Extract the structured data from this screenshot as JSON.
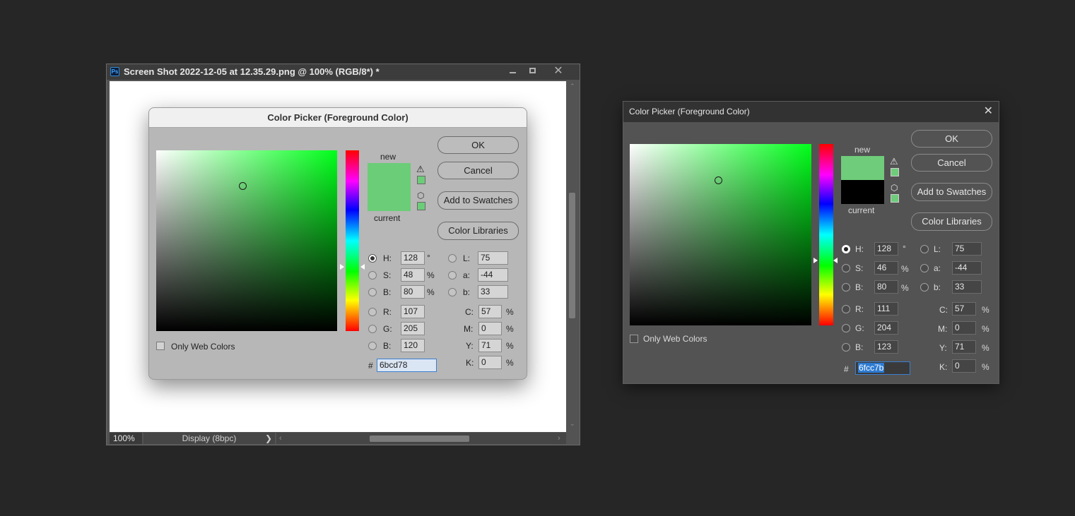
{
  "ps_window": {
    "title": "Screen Shot 2022-12-05 at 12.35.29.png @ 100% (RGB/8*) *",
    "logo": "Ps",
    "close_glyph": "✕",
    "zoom": "100%",
    "doc_info": "Display (8bpc)",
    "doc_info_arrow": "❯",
    "scroll_left": "‹",
    "scroll_right": "›",
    "scroll_up": "⌃",
    "scroll_down": "⌄"
  },
  "picker_light": {
    "title": "Color Picker (Foreground Color)",
    "new_label": "new",
    "current_label": "current",
    "new_color": "#6bcd78",
    "current_color": "#6bcd78",
    "hue_color": "#00ff1a",
    "buttons": {
      "ok": "OK",
      "cancel": "Cancel",
      "add_swatches": "Add to Swatches",
      "color_libraries": "Color Libraries"
    },
    "only_web_colors": "Only Web Colors",
    "fields": {
      "h": {
        "label": "H:",
        "value": "128",
        "unit": "°"
      },
      "s": {
        "label": "S:",
        "value": "48",
        "unit": "%"
      },
      "b": {
        "label": "B:",
        "value": "80",
        "unit": "%"
      },
      "r": {
        "label": "R:",
        "value": "107"
      },
      "g": {
        "label": "G:",
        "value": "205"
      },
      "bb": {
        "label": "B:",
        "value": "120"
      },
      "l": {
        "label": "L:",
        "value": "75"
      },
      "a": {
        "label": "a:",
        "value": "-44"
      },
      "lab_b": {
        "label": "b:",
        "value": "33"
      },
      "c": {
        "label": "C:",
        "value": "57",
        "unit": "%"
      },
      "m": {
        "label": "M:",
        "value": "0",
        "unit": "%"
      },
      "y": {
        "label": "Y:",
        "value": "71",
        "unit": "%"
      },
      "k": {
        "label": "K:",
        "value": "0",
        "unit": "%"
      }
    },
    "hash": "#",
    "hex": "6bcd78"
  },
  "picker_dark": {
    "title": "Color Picker (Foreground Color)",
    "close_glyph": "✕",
    "new_label": "new",
    "current_label": "current",
    "new_color": "#6fcc7b",
    "current_color": "#000000",
    "hue_color": "#00ff1a",
    "buttons": {
      "ok": "OK",
      "cancel": "Cancel",
      "add_swatches": "Add to Swatches",
      "color_libraries": "Color Libraries"
    },
    "only_web_colors": "Only Web Colors",
    "fields": {
      "h": {
        "label": "H:",
        "value": "128",
        "unit": "°"
      },
      "s": {
        "label": "S:",
        "value": "46",
        "unit": "%"
      },
      "b": {
        "label": "B:",
        "value": "80",
        "unit": "%"
      },
      "r": {
        "label": "R:",
        "value": "111"
      },
      "g": {
        "label": "G:",
        "value": "204"
      },
      "bb": {
        "label": "B:",
        "value": "123"
      },
      "l": {
        "label": "L:",
        "value": "75"
      },
      "a": {
        "label": "a:",
        "value": "-44"
      },
      "lab_b": {
        "label": "b:",
        "value": "33"
      },
      "c": {
        "label": "C:",
        "value": "57",
        "unit": "%"
      },
      "m": {
        "label": "M:",
        "value": "0",
        "unit": "%"
      },
      "y": {
        "label": "Y:",
        "value": "71",
        "unit": "%"
      },
      "k": {
        "label": "K:",
        "value": "0",
        "unit": "%"
      }
    },
    "hash": "#",
    "hex": "6fcc7b"
  },
  "icons": {
    "warning": "⚠",
    "cube": "⬡"
  }
}
